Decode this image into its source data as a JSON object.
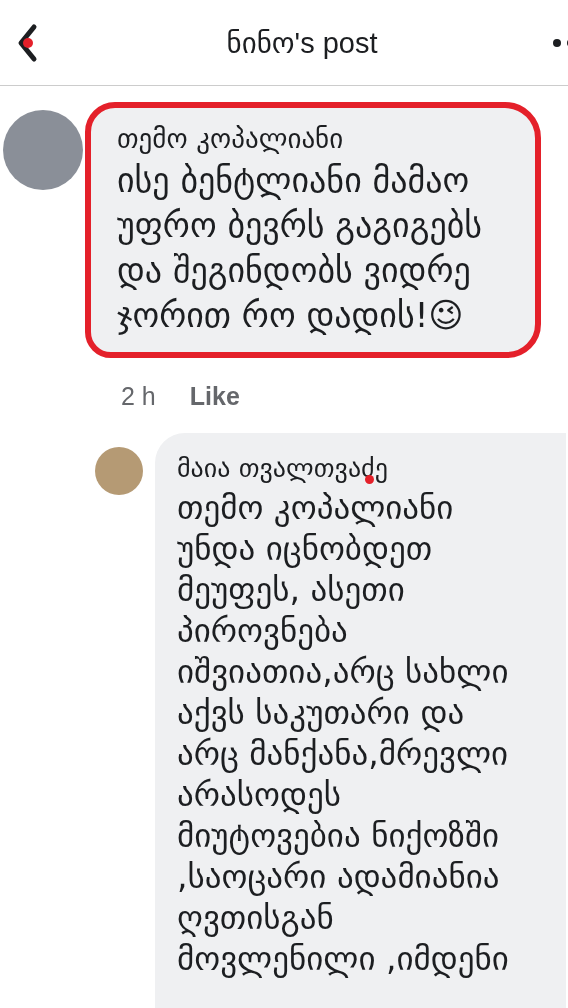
{
  "header": {
    "title": "ნინო's post"
  },
  "comments": [
    {
      "author": "თემო კოპალიანი",
      "text": "ისე ბენტლიანი მამაო\nუფრო ბევრს გაგიგებს\nდა შეგინდობს ვიდრე\nჯორით რო დადის!😉",
      "time": "2 h",
      "action": "Like",
      "highlighted": true,
      "reply": false
    },
    {
      "author": "მაია თვალთვაძე",
      "text": "თემო კოპალიანი\nუნდა იცნობდეთ\nმეუფეს, ასეთი\nპიროვნება\nიშვიათია,არც სახლი\nაქვს საკუთარი და\nარც მანქანა,მრევლი\nარასოდეს\nმიუტოვებია ნიქოზში\n,საოცარი ადამიანია\nღვთისგან\nმოვლენილი ,იმდენი",
      "highlighted": false,
      "reply": true
    }
  ]
}
